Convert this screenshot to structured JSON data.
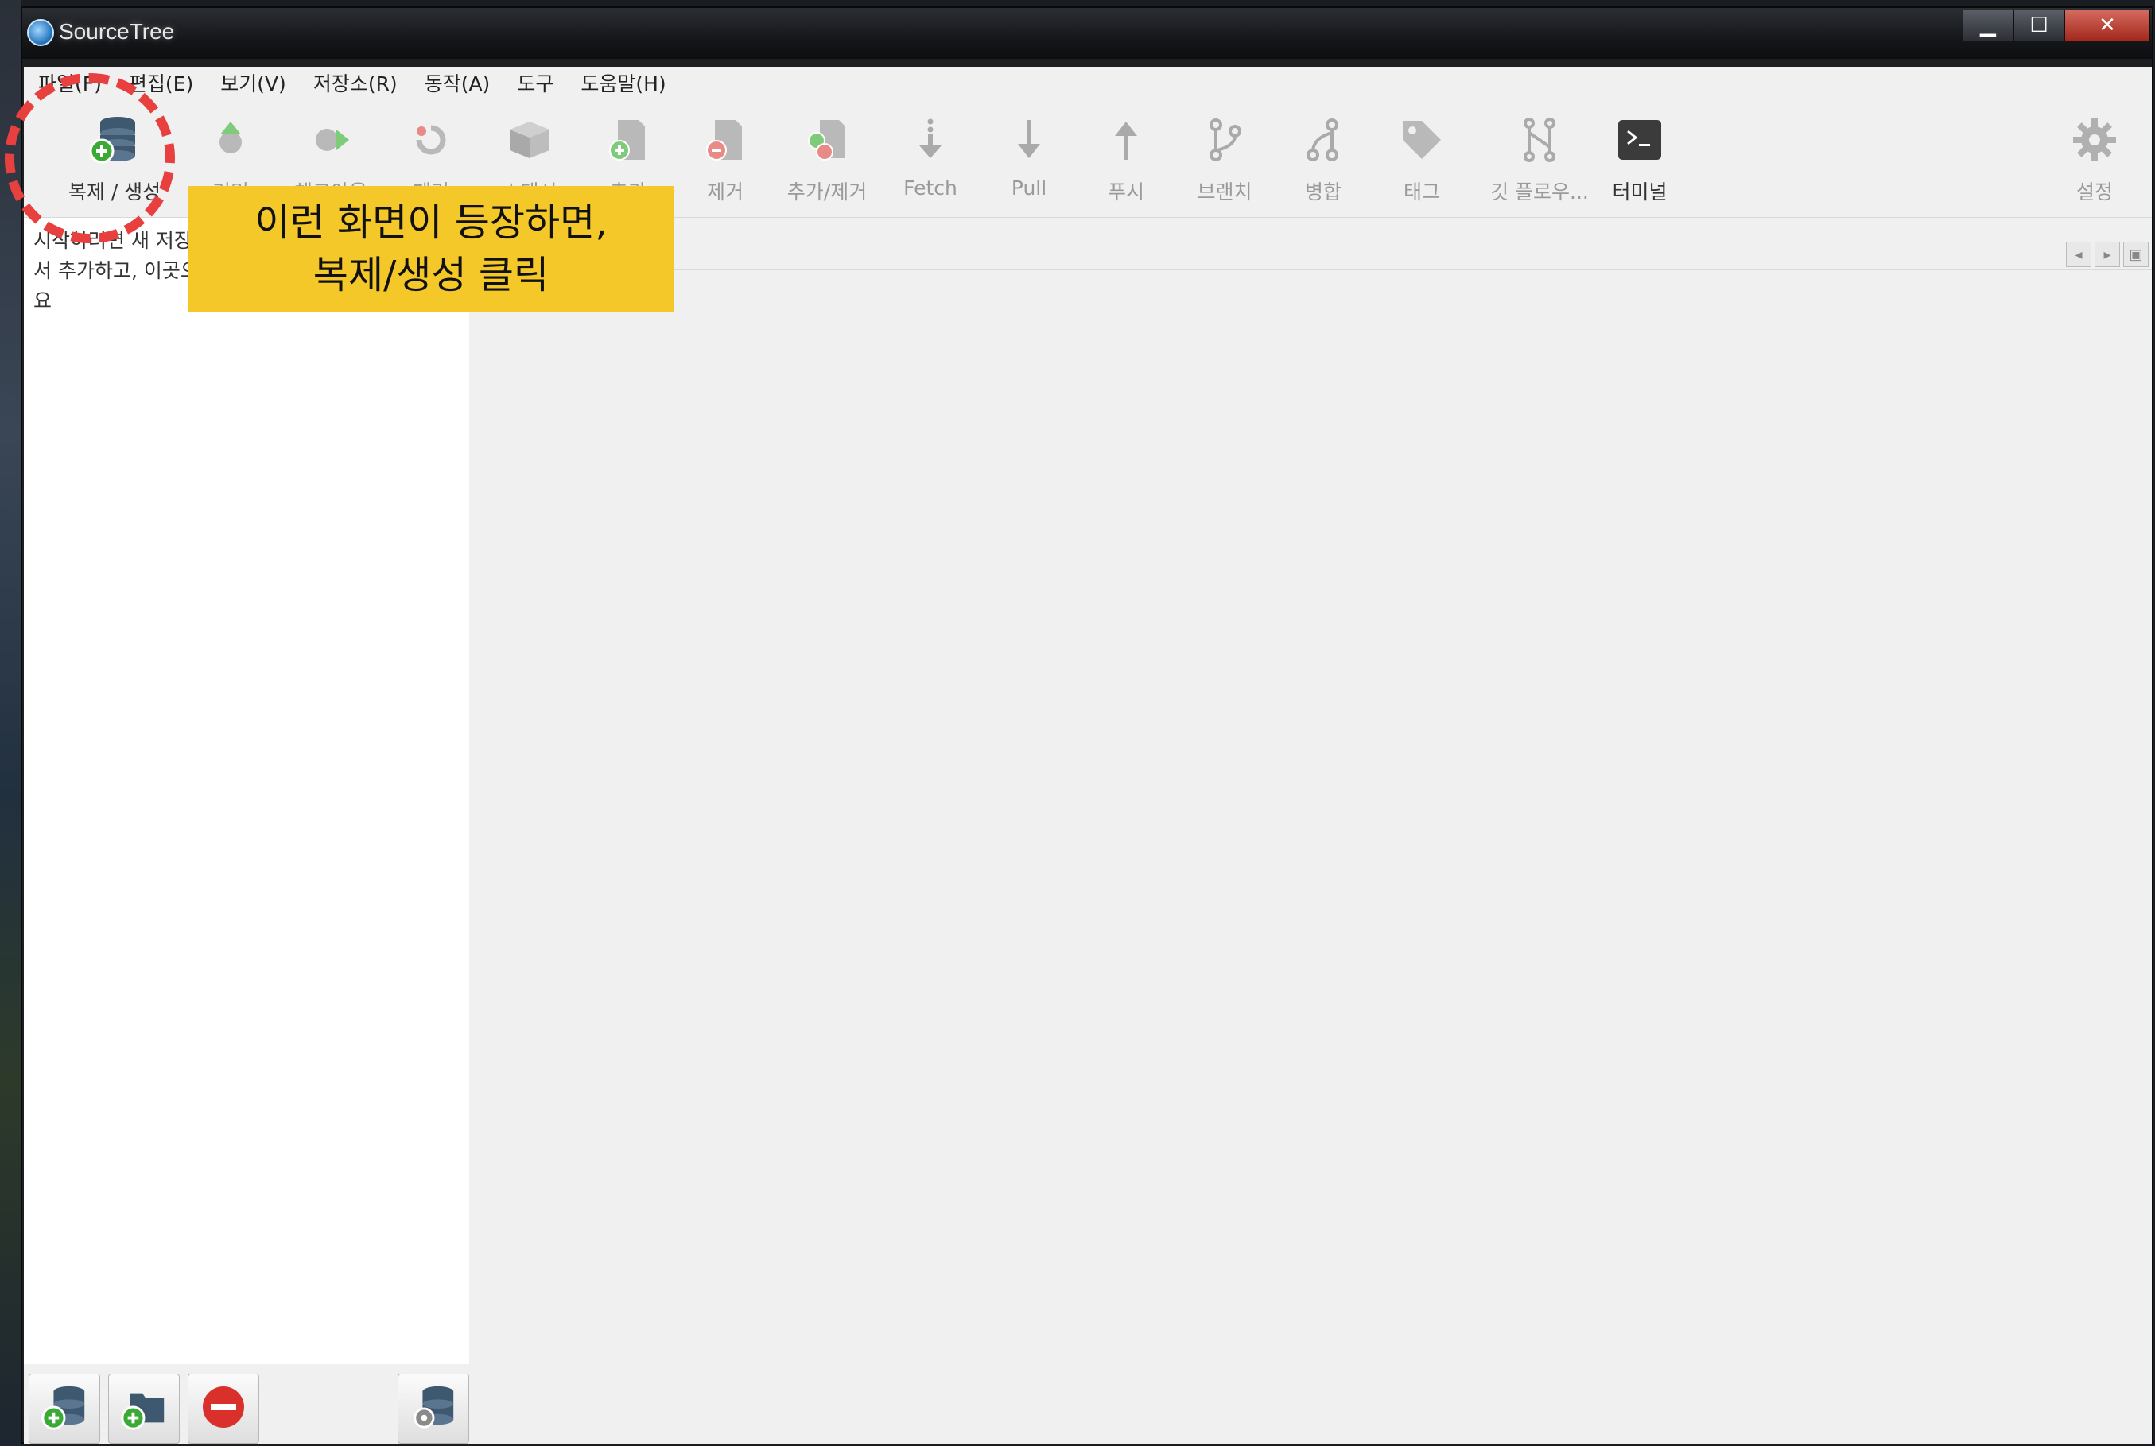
{
  "window": {
    "title": "SourceTree",
    "minimize": "▁",
    "maximize": "☐",
    "close": "✕"
  },
  "menu": [
    "파일(F)",
    "편집(E)",
    "보기(V)",
    "저장소(R)",
    "동작(A)",
    "도구",
    "도움말(H)"
  ],
  "toolbar": {
    "clone": "복제 / 생성",
    "commit": "커밋",
    "checkout": "체크아웃",
    "discard": "폐기",
    "stash": "스태시",
    "add": "추가",
    "remove": "제거",
    "addremove": "추가/제거",
    "fetch": "Fetch",
    "pull": "Pull",
    "push": "푸시",
    "branch": "브랜치",
    "merge": "병합",
    "tag": "태그",
    "gitflow": "깃 플로우...",
    "terminal": "터미널",
    "settings": "설정"
  },
  "sidebar": {
    "message": "시작하려면 새 저장소를 복제/생성하거나 드래그해서 추가하고, 이곳으로 저장소 폴더를 끌어다 놓으세요"
  },
  "callout": {
    "line1": "이런 화면이 등장하면,",
    "line2": "복제/생성 클릭"
  },
  "colors": {
    "accent_callout": "#f5c82a",
    "ring": "#e8403f",
    "green": "#3aaa35",
    "red": "#d9302c"
  }
}
